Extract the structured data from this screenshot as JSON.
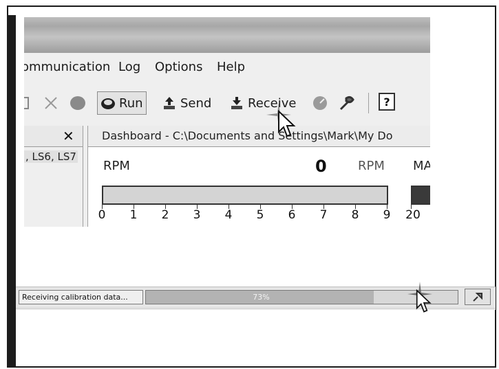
{
  "menu": {
    "communication": "ommunication",
    "log": "Log",
    "options": "Options",
    "help": "Help"
  },
  "toolbar": {
    "run": "Run",
    "send": "Send",
    "receive": "Receive",
    "help": "?"
  },
  "left_pane": {
    "close": "✕",
    "item": ", LS6, LS7"
  },
  "dashboard": {
    "tab_title": "Dashboard - C:\\Documents and Settings\\Mark\\My Do",
    "rpm_label": "RPM",
    "rpm_value": "0",
    "rpm_unit": "RPM",
    "second_label": "MA",
    "gauge_level": 0,
    "ticks": [
      "0",
      "1",
      "2",
      "3",
      "4",
      "5",
      "6",
      "7",
      "8",
      "9"
    ],
    "second_tick": "20"
  },
  "status_bar": {
    "message": "Receiving calibration data...",
    "progress_percent": 73,
    "progress_text": "73%"
  },
  "colors": {
    "gauge_bg": "#d4d4d4",
    "frame": "#1a1a1a",
    "progress_fill": "#b3b3b3"
  },
  "icons": {
    "cursor": "arrow-cursor-icon",
    "sparkle": "click-sparkle-icon",
    "status_button": "pin-icon"
  }
}
